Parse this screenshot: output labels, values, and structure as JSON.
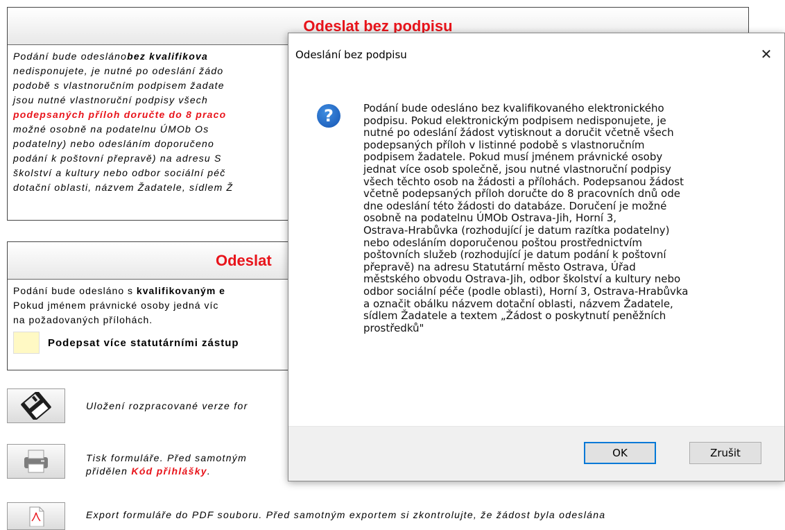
{
  "panel1": {
    "title": "Odeslat bez podpisu",
    "lines": [
      [
        "Podání bude odesláno",
        "bez kvalifikova"
      ],
      [
        "nedisponujete, je nutné po odeslání žádo"
      ],
      [
        "podobě s vlastnoručním podpisem žadate"
      ],
      [
        "jsou nutné vlastnoruční podpisy všech"
      ],
      [
        "podepsaných příloh doručte do 8 praco"
      ],
      [
        "možné osobně na podatelnu ÚMOb Os"
      ],
      [
        "podatelny) nebo odesláním doporučeno"
      ],
      [
        "podání k poštovní přepravě) na adresu S"
      ],
      [
        "školství a kultury nebo odbor sociální péč"
      ],
      [
        "dotační oblasti, názvem Žadatele, sídlem Ž"
      ]
    ]
  },
  "panel2": {
    "title": "Odeslat",
    "line1_a": "Podání bude odesláno s ",
    "line1_b": "kvalifikovaným e",
    "line2": "Pokud jménem právnické osoby jedná víc",
    "line3": "na požadovaných přílohách.",
    "sign_label": "Podepsat více statutárními zástup",
    "sign_color": "#fff9c4"
  },
  "actions": {
    "save_text": "Uložení rozpracované verze for",
    "print_text_1": "Tisk formuláře. Před samotným",
    "print_text_2a": "přidělen ",
    "print_text_2b": "Kód přihlášky",
    "print_text_2c": ".",
    "export_text": "Export formuláře do PDF souboru. Před samotným exportem si zkontrolujte, že žádost byla odeslána",
    "icons": [
      "floppy-disk-icon",
      "printer-icon",
      "pdf-file-icon"
    ]
  },
  "dialog": {
    "title": "Odeslání bez podpisu",
    "close_glyph": "✕",
    "icon_glyph": "?",
    "message_lines": [
      "Podání bude odesláno bez kvalifikovaného elektronického",
      "podpisu. Pokud elektronickým podpisem nedisponujete, je",
      "nutné po odeslání žádost vytisknout a doručit včetně všech",
      "podepsaných příloh v listinné podobě s vlastnoručním",
      "podpisem žadatele. Pokud musí jménem právnické osoby",
      "jednat více osob společně, jsou nutné vlastnoruční podpisy",
      "všech těchto osob na žádosti a přílohách. Podepsanou žádost",
      "včetně podepsaných příloh doručte do 8 pracovních dnů ode",
      "dne odeslání této žádosti do databáze. Doručení je možné",
      "osobně na podatelnu ÚMOb Ostrava-Jih, Horní 3,",
      "Ostrava-Hrabůvka (rozhodující je datum razítka podatelny)",
      "nebo odesláním doporučenou poštou prostřednictvím",
      "poštovních služeb (rozhodující je datum podání k poštovní",
      "přepravě) na adresu Statutární město Ostrava, Úřad",
      "městského obvodu Ostrava-Jih, odbor školství a kultury nebo",
      "odbor sociální péče (podle oblasti), Horní 3, Ostrava-Hrabůvka",
      "a označit obálku názvem dotační oblasti, názvem Žadatele,",
      "sídlem Žadatele a textem „Žádost o poskytnutí peněžních",
      "prostředků\""
    ],
    "ok_label": "OK",
    "cancel_label": "Zrušit",
    "accent_color": "#0078d7"
  }
}
